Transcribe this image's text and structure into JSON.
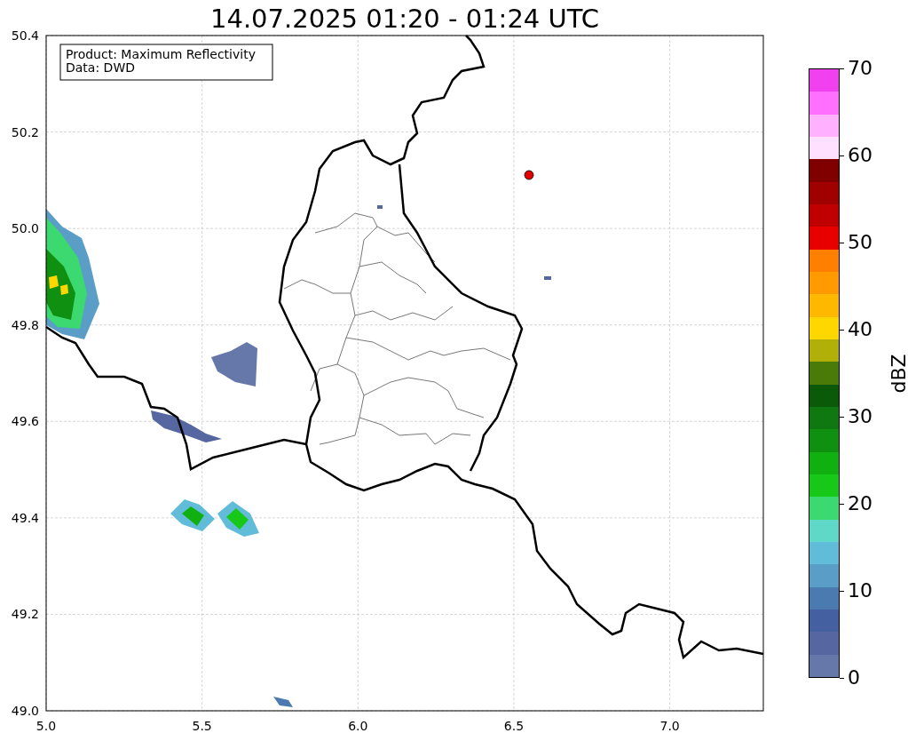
{
  "title": "14.07.2025 01:20 - 01:24 UTC",
  "info_box": [
    "Product: Maximum Reflectivity",
    "Data: DWD"
  ],
  "map": {
    "xticks": [
      "5.0",
      "5.5",
      "6.0",
      "6.5",
      "7.0"
    ],
    "yticks": [
      "50.4",
      "50.2",
      "50.0",
      "49.8",
      "49.6",
      "49.4",
      "49.2",
      "49.0"
    ]
  },
  "colorbar": {
    "label": "dBZ",
    "ticks": [
      "70",
      "60",
      "50",
      "40",
      "30",
      "20",
      "10",
      "0"
    ],
    "bands": [
      {
        "color": "#6677aa"
      },
      {
        "color": "#5566a0"
      },
      {
        "color": "#4460a0"
      },
      {
        "color": "#4a7ab0"
      },
      {
        "color": "#5a9ec8"
      },
      {
        "color": "#60bcd8"
      },
      {
        "color": "#60d8c8"
      },
      {
        "color": "#3cd870"
      },
      {
        "color": "#18c818"
      },
      {
        "color": "#10b010"
      },
      {
        "color": "#109010"
      },
      {
        "color": "#107810"
      },
      {
        "color": "#0a5a0a"
      },
      {
        "color": "#4a7a08"
      },
      {
        "color": "#b0b008"
      },
      {
        "color": "#ffd700"
      },
      {
        "color": "#ffb800"
      },
      {
        "color": "#ff9a00"
      },
      {
        "color": "#ff7f00"
      },
      {
        "color": "#e80000"
      },
      {
        "color": "#c00000"
      },
      {
        "color": "#a00000"
      },
      {
        "color": "#800000"
      },
      {
        "color": "#ffe0ff"
      },
      {
        "color": "#ffb0ff"
      },
      {
        "color": "#ff70ff"
      },
      {
        "color": "#f040f0"
      }
    ]
  }
}
